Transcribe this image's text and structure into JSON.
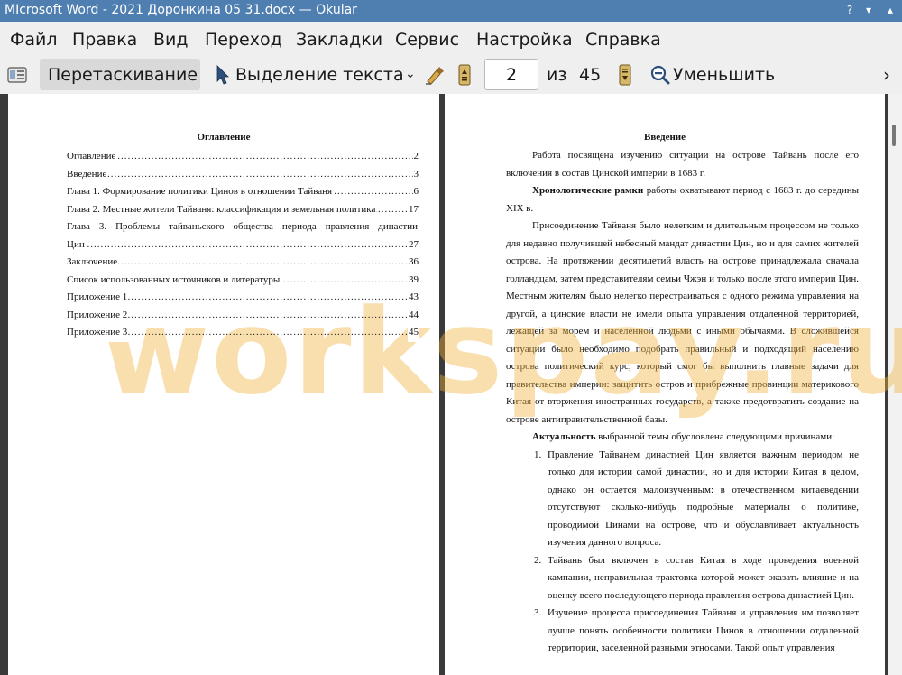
{
  "window": {
    "title": "MIcrosoft Word - 2021 Доронкина 05 31.docx  — Okular",
    "buttons": {
      "help": "?",
      "minimize": "▾",
      "maximize": "▴",
      "close": "✕"
    }
  },
  "menu": [
    "Файл",
    "Правка",
    "Вид",
    "Переход",
    "Закладки",
    "Сервис",
    "Настройка",
    "Справка"
  ],
  "toolbar": {
    "drag_label": "Перетаскивание",
    "select_label": "Выделение текста",
    "page_value": "2",
    "of_label": "из",
    "total_pages": "45",
    "zoom_out_label": "Уменьшить",
    "more": "›"
  },
  "page1": {
    "title": "Оглавление",
    "toc": [
      {
        "text": "Оглавление",
        "page": "2"
      },
      {
        "text": "Введение",
        "page": "3"
      },
      {
        "text": "Глава 1. Формирование политики Цинов в отношении Тайваня",
        "page": "6"
      },
      {
        "text": "Глава 2. Местные жители Тайваня: классификация и земельная политика",
        "page": "17"
      },
      {
        "text": "Глава 3. Проблемы тайваньского общества периода правления династии",
        "page": ""
      },
      {
        "text": "Цин",
        "page": "27"
      },
      {
        "text": "Заключение",
        "page": "36"
      },
      {
        "text": "Список использованных источников и литературы",
        "page": "39"
      },
      {
        "text": "Приложение 1",
        "page": "43"
      },
      {
        "text": "Приложение 2",
        "page": "44"
      },
      {
        "text": "Приложение 3",
        "page": "45"
      }
    ]
  },
  "page2": {
    "title": "Введение",
    "para1": "Работа посвящена изучению ситуации на острове Тайвань после его включения в состав Цинской империи в 1683 г.",
    "para2_bold": "Хронологические рамки",
    "para2_rest": " работы охватывают период с 1683 г. до середины XIX в.",
    "para3": "Присоединение Тайваня было нелегким и длительным процессом не только для недавно получившей небесный мандат династии Цин, но и для самих жителей острова. На протяжении десятилетий власть на острове принадлежала сначала голландцам, затем представителям семьи Чжэн и только после этого империи Цин. Местным жителям было нелегко перестраиваться с одного режима управления на другой, а цинские власти не имели опыта управления отдаленной территорией, лежащей за морем и населенной людьми с иными обычаями. В сложившейся ситуации было необходимо подобрать правильный и подходящий населению острова политический курс, который смог бы выполнить главные задачи для правительства империи: защитить остров и прибрежные провинции материкового Китая от вторжения иностранных государств, а также предотвратить создание на острове антиправительственной базы.",
    "para4_bold": "Актуальность",
    "para4_rest": " выбранной темы обусловлена следующими причинами:",
    "list": [
      "Правление Тайванем династией Цин является важным периодом не только для истории самой династии, но и для истории Китая в целом, однако он остается малоизученным: в отечественном китаеведении отсутствуют сколько-нибудь подробные материалы о политике, проводимой Цинами на острове, что и обуславливает актуальность изучения данного вопроса.",
      "Тайвань был включен в состав Китая в ходе проведения военной кампании, неправильная трактовка которой может оказать влияние и на оценку всего последующего периода правления острова династией Цин.",
      "Изучение процесса присоединения Тайваня и управления им позволяет лучше понять особенности политики Цинов в отношении отдаленной территории, заселенной разными этносами. Такой опыт управления"
    ]
  },
  "watermark": "workspay.ru",
  "colors": {
    "titlebar": "#4f7fb1",
    "watermark": "#f0b23c",
    "viewer_bg": "#3a3a3a"
  },
  "icons": {
    "sidebar": "sidebar-toggle-icon",
    "select": "cursor-arrow-icon",
    "annotate": "highlighter-icon",
    "prev": "page-previous-icon",
    "next": "page-next-icon",
    "zoom": "zoom-out-icon"
  }
}
